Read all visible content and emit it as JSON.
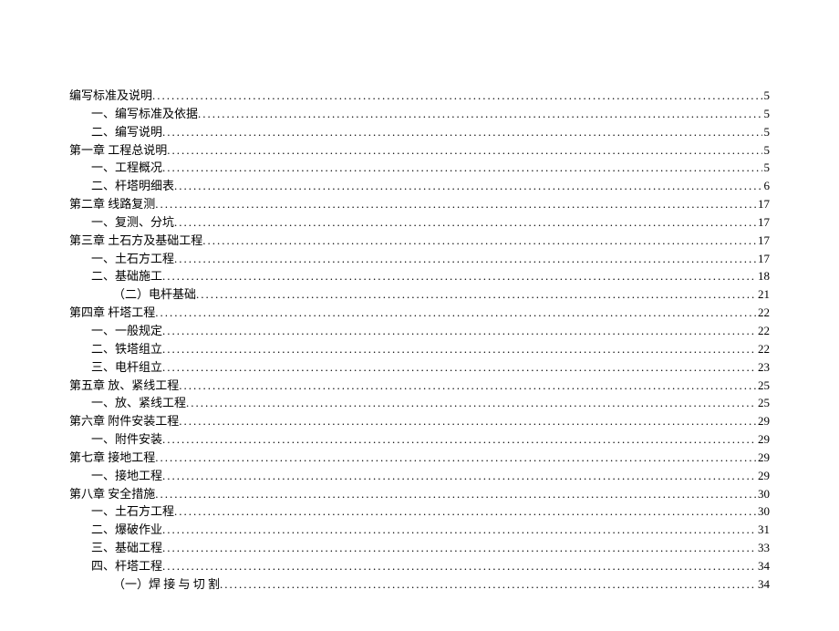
{
  "toc": [
    {
      "level": 0,
      "title": "编写标准及说明",
      "page": "5"
    },
    {
      "level": 1,
      "title": "一、编写标准及依据",
      "page": "5"
    },
    {
      "level": 1,
      "title": "二、编写说明",
      "page": "5"
    },
    {
      "level": 0,
      "title": "第一章  工程总说明",
      "page": "5"
    },
    {
      "level": 1,
      "title": "一、工程概况",
      "page": "5"
    },
    {
      "level": 1,
      "title": "二、杆塔明细表",
      "page": "6"
    },
    {
      "level": 0,
      "title": "第二章   线路复测",
      "page": "17"
    },
    {
      "level": 1,
      "title": "一、复测、分坑",
      "page": "17"
    },
    {
      "level": 0,
      "title": "第三章   土石方及基础工程",
      "page": "17"
    },
    {
      "level": 1,
      "title": "一、土石方工程",
      "page": "17"
    },
    {
      "level": 1,
      "title": "二、基础施工",
      "page": "18"
    },
    {
      "level": 2,
      "title": "（二）电杆基础",
      "page": "21"
    },
    {
      "level": 0,
      "title": "第四章    杆塔工程",
      "page": "22"
    },
    {
      "level": 1,
      "title": "一、一般规定",
      "page": "22"
    },
    {
      "level": 1,
      "title": "二、铁塔组立",
      "page": "22"
    },
    {
      "level": 1,
      "title": "三、电杆组立",
      "page": "23"
    },
    {
      "level": 0,
      "title": "第五章   放、紧线工程",
      "page": "25"
    },
    {
      "level": 1,
      "title": "一、放、紧线工程",
      "page": "25"
    },
    {
      "level": 0,
      "title": "第六章   附件安装工程",
      "page": "29"
    },
    {
      "level": 1,
      "title": "一、附件安装",
      "page": "29"
    },
    {
      "level": 0,
      "title": "第七章   接地工程",
      "page": "29"
    },
    {
      "level": 1,
      "title": "一、接地工程",
      "page": "29"
    },
    {
      "level": 0,
      "title": "第八章   安全措施",
      "page": "30"
    },
    {
      "level": 1,
      "title": "一、土石方工程",
      "page": "30"
    },
    {
      "level": 1,
      "title": "二、爆破作业",
      "page": "31"
    },
    {
      "level": 1,
      "title": "三、基础工程",
      "page": "33"
    },
    {
      "level": 1,
      "title": "四、杆塔工程",
      "page": "34"
    },
    {
      "level": 2,
      "title": "（一）焊  接  与  切  割",
      "page": "34"
    }
  ]
}
